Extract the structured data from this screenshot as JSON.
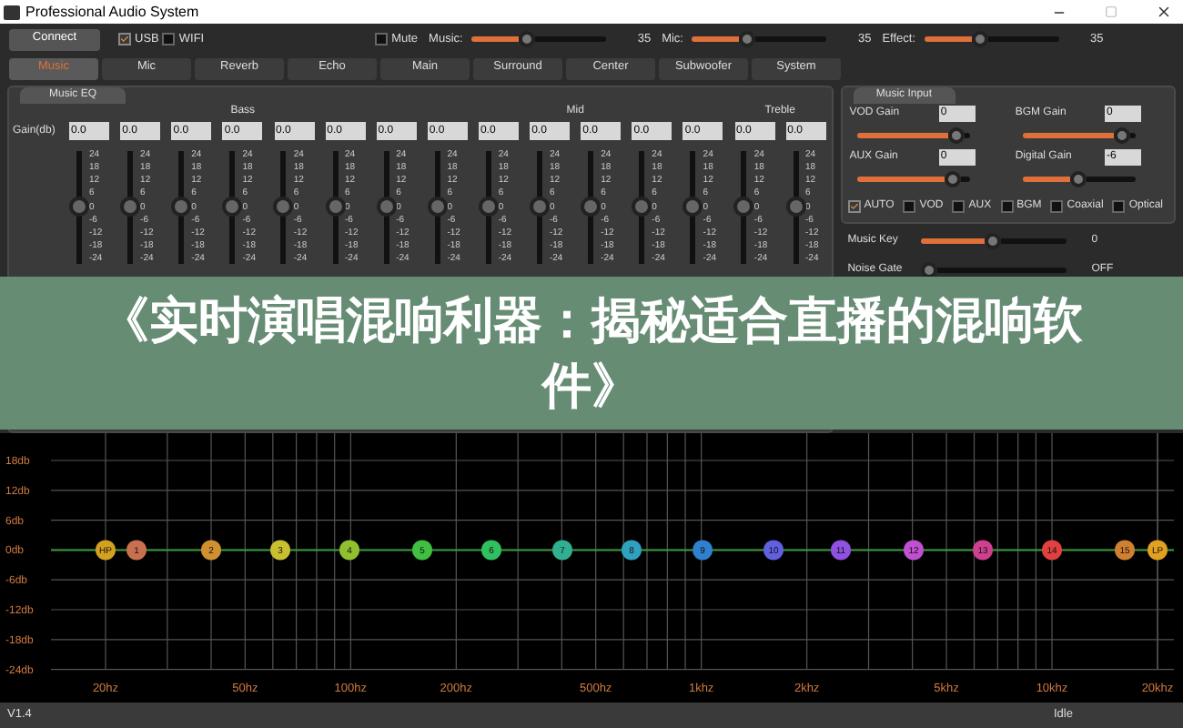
{
  "window": {
    "title": "Professional Audio System"
  },
  "toolbar": {
    "connect": "Connect",
    "options": [
      {
        "label": "USB",
        "checked": true
      },
      {
        "label": "WIFI",
        "checked": false
      }
    ],
    "mute": {
      "label": "Mute",
      "checked": false
    },
    "sliders": [
      {
        "label": "Music:",
        "level": 0.4,
        "reading": "35"
      },
      {
        "label": "Mic:",
        "level": 0.4,
        "reading": "35"
      },
      {
        "label": "Effect:",
        "level": 0.4,
        "reading": "35"
      }
    ]
  },
  "tabs": [
    {
      "label": "Music",
      "selected": true
    },
    {
      "label": "Mic",
      "selected": false
    },
    {
      "label": "Reverb",
      "selected": false
    },
    {
      "label": "Echo",
      "selected": false
    },
    {
      "label": "Main",
      "selected": false
    },
    {
      "label": "Surround",
      "selected": false
    },
    {
      "label": "Center",
      "selected": false
    },
    {
      "label": "Subwoofer",
      "selected": false
    },
    {
      "label": "System",
      "selected": false
    }
  ],
  "music_eq": {
    "title": "Music EQ",
    "groups": [
      "Bass",
      "Mid",
      "Treble"
    ],
    "gain_label": "Gain(db)",
    "bands": [
      {
        "gain": "0.0",
        "level": 0.5,
        "scale": [
          "24",
          "18",
          "12",
          "6",
          "0",
          "-6",
          "-12",
          "-18",
          "-24"
        ]
      },
      {
        "gain": "0.0",
        "level": 0.5,
        "scale": [
          "24",
          "18",
          "12",
          "6",
          "0",
          "-6",
          "-12",
          "-18",
          "-24"
        ]
      },
      {
        "gain": "0.0",
        "level": 0.5,
        "scale": [
          "24",
          "18",
          "12",
          "6",
          "0",
          "-6",
          "-12",
          "-18",
          "-24"
        ]
      },
      {
        "gain": "0.0",
        "level": 0.5,
        "scale": [
          "24",
          "18",
          "12",
          "6",
          "0",
          "-6",
          "-12",
          "-18",
          "-24"
        ]
      },
      {
        "gain": "0.0",
        "level": 0.5,
        "scale": [
          "24",
          "18",
          "12",
          "6",
          "0",
          "-6",
          "-12",
          "-18",
          "-24"
        ]
      },
      {
        "gain": "0.0",
        "level": 0.5,
        "scale": [
          "24",
          "18",
          "12",
          "6",
          "0",
          "-6",
          "-12",
          "-18",
          "-24"
        ]
      },
      {
        "gain": "0.0",
        "level": 0.5,
        "scale": [
          "24",
          "18",
          "12",
          "6",
          "0",
          "-6",
          "-12",
          "-18",
          "-24"
        ]
      },
      {
        "gain": "0.0",
        "level": 0.5,
        "scale": [
          "24",
          "18",
          "12",
          "6",
          "0",
          "-6",
          "-12",
          "-18",
          "-24"
        ]
      },
      {
        "gain": "0.0",
        "level": 0.5,
        "scale": [
          "24",
          "18",
          "12",
          "6",
          "0",
          "-6",
          "-12",
          "-18",
          "-24"
        ]
      },
      {
        "gain": "0.0",
        "level": 0.5,
        "scale": [
          "24",
          "18",
          "12",
          "6",
          "0",
          "-6",
          "-12",
          "-18",
          "-24"
        ]
      },
      {
        "gain": "0.0",
        "level": 0.5,
        "scale": [
          "24",
          "18",
          "12",
          "6",
          "0",
          "-6",
          "-12",
          "-18",
          "-24"
        ]
      },
      {
        "gain": "0.0",
        "level": 0.5,
        "scale": [
          "24",
          "18",
          "12",
          "6",
          "0",
          "-6",
          "-12",
          "-18",
          "-24"
        ]
      },
      {
        "gain": "0.0",
        "level": 0.5,
        "scale": [
          "24",
          "18",
          "12",
          "6",
          "0",
          "-6",
          "-12",
          "-18",
          "-24"
        ]
      },
      {
        "gain": "0.0",
        "level": 0.5,
        "scale": [
          "24",
          "18",
          "12",
          "6",
          "0",
          "-6",
          "-12",
          "-18",
          "-24"
        ]
      },
      {
        "gain": "0.0",
        "level": 0.5,
        "scale": [
          "24",
          "18",
          "12",
          "6",
          "0",
          "-6",
          "-12",
          "-18",
          "-24"
        ]
      }
    ]
  },
  "music_input": {
    "title": "Music Input",
    "gains": [
      {
        "label": "VOD Gain",
        "value": "0",
        "level": 0.95
      },
      {
        "label": "BGM Gain",
        "value": "0",
        "level": 0.95
      },
      {
        "label": "AUX Gain",
        "value": "0",
        "level": 0.92
      },
      {
        "label": "Digital Gain",
        "value": "-6",
        "level": 0.5
      }
    ],
    "sources": [
      {
        "label": "AUTO",
        "checked": true
      },
      {
        "label": "VOD",
        "checked": false
      },
      {
        "label": "AUX",
        "checked": false
      },
      {
        "label": "BGM",
        "checked": false
      },
      {
        "label": "Coaxial",
        "checked": false
      },
      {
        "label": "Optical",
        "checked": false
      }
    ]
  },
  "controls": [
    {
      "label": "Music Key",
      "level": 0.5,
      "reading": "0"
    },
    {
      "label": "Noise Gate",
      "level": 0,
      "reading": "OFF"
    }
  ],
  "overlay_caption": "《实时演唱混响利器：揭秘适合直播的混响软件》",
  "graph": {
    "y_labels": [
      "18db",
      "12db",
      "6db",
      "0db",
      "-6db",
      "-12db",
      "-18db",
      "-24db"
    ],
    "x_labels": [
      "20hz",
      "50hz",
      "100hz",
      "200hz",
      "500hz",
      "1khz",
      "2khz",
      "5khz",
      "10khz",
      "20khz"
    ],
    "points": [
      {
        "label": "HP",
        "color": "#d4a020"
      },
      {
        "label": "1",
        "color": "#c87050"
      },
      {
        "label": "2",
        "color": "#d09030"
      },
      {
        "label": "3",
        "color": "#c8c030"
      },
      {
        "label": "4",
        "color": "#90c030"
      },
      {
        "label": "5",
        "color": "#40c040"
      },
      {
        "label": "6",
        "color": "#30c060"
      },
      {
        "label": "7",
        "color": "#30b090"
      },
      {
        "label": "8",
        "color": "#30a0c0"
      },
      {
        "label": "9",
        "color": "#3080d0"
      },
      {
        "label": "10",
        "color": "#6060e0"
      },
      {
        "label": "11",
        "color": "#9050e0"
      },
      {
        "label": "12",
        "color": "#c050d0"
      },
      {
        "label": "13",
        "color": "#d04090"
      },
      {
        "label": "14",
        "color": "#e04040"
      },
      {
        "label": "15",
        "color": "#d08030"
      },
      {
        "label": "LP",
        "color": "#e0a020"
      }
    ]
  },
  "status_bar": {
    "version": "V1.4",
    "state": "Idle"
  }
}
